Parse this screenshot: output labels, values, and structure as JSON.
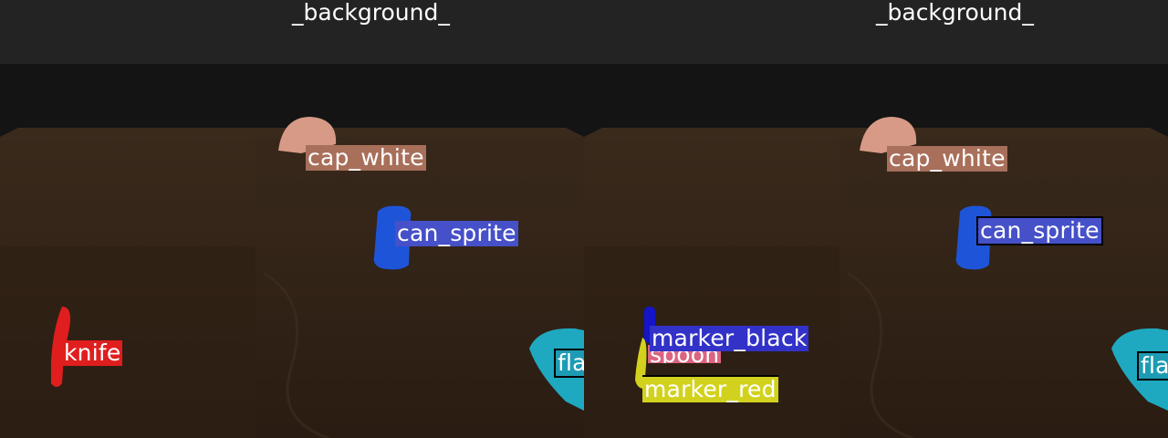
{
  "panels": [
    {
      "background_label": "_background_",
      "labels": {
        "cap_white": "cap_white",
        "can_sprite": "can_sprite",
        "knife": "knife",
        "flash_partial": "fla"
      }
    },
    {
      "background_label": "_background_",
      "labels": {
        "cap_white": "cap_white",
        "can_sprite": "can_sprite",
        "marker_black": "marker_black",
        "spoon_partial": "spoon",
        "marker_red": "marker_red",
        "flash_partial": "fla"
      }
    }
  ],
  "colors": {
    "cap_white": "#a86f5a",
    "can_sprite": "#4650c8",
    "knife": "#e01e1e",
    "marker_black": "#3232c8",
    "spoon": "#dc6480",
    "marker_red": "#d2d21e",
    "flash": "#1e9bb4"
  }
}
